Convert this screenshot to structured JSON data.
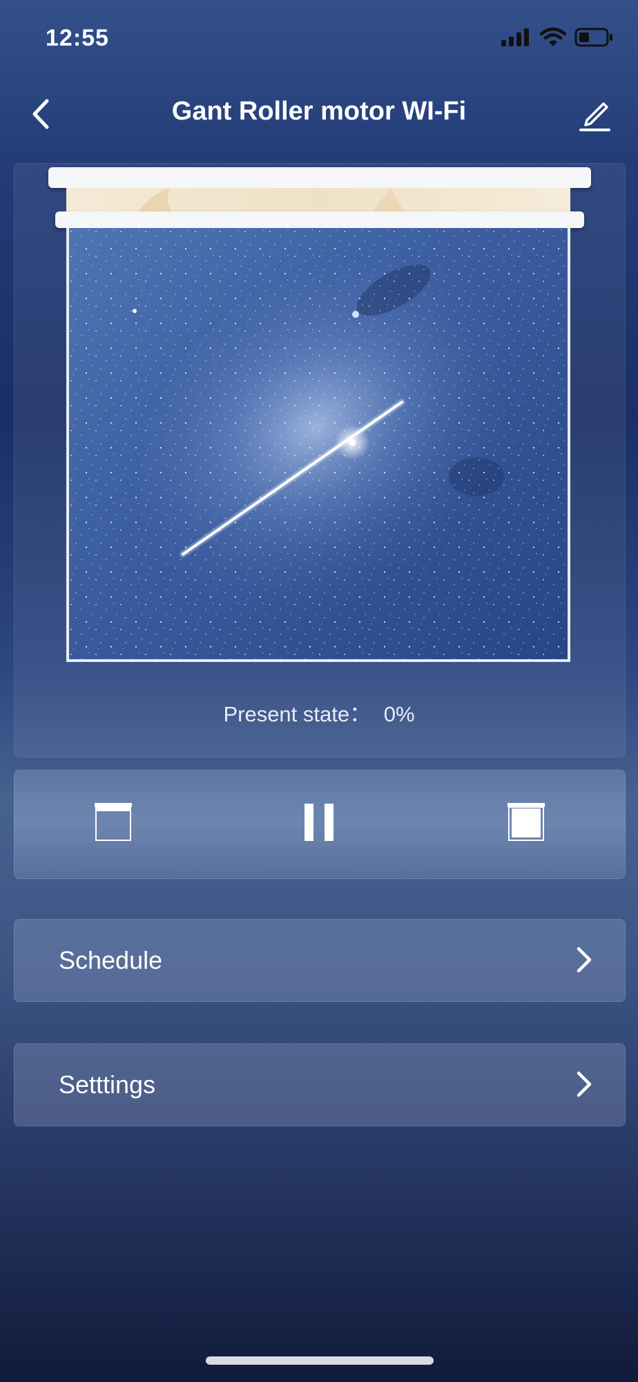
{
  "status": {
    "time": "12:55",
    "icons": [
      "signal-icon",
      "wifi-icon",
      "battery-icon"
    ]
  },
  "header": {
    "title": "Gant Roller motor WI-Fi",
    "back_icon": "chevron-left-icon",
    "edit_icon": "pencil-icon"
  },
  "device": {
    "preview_image": "starry-sky-with-shooting-star",
    "present_state_label": "Present state：",
    "present_state_value": "0%",
    "position_percent": 0
  },
  "controls": {
    "open_icon": "blind-open-icon",
    "pause_icon": "pause-icon",
    "close_icon": "blind-close-icon"
  },
  "menu": [
    {
      "label": "Schedule",
      "icon": "chevron-right-icon"
    },
    {
      "label": "Setttings",
      "icon": "chevron-right-icon"
    }
  ],
  "colors": {
    "background_top": "#34508a",
    "background_bottom": "#111a3a",
    "rail": "#f5f6f8"
  }
}
